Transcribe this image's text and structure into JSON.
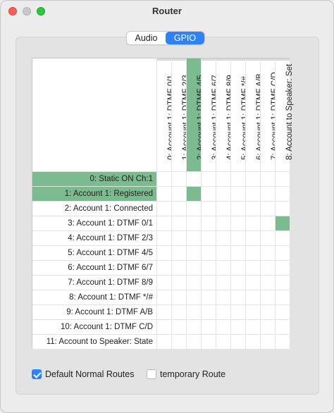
{
  "window": {
    "title": "Router"
  },
  "tabs": [
    {
      "label": "Audio",
      "active": false
    },
    {
      "label": "GPIO",
      "active": true
    }
  ],
  "accent_color": "#2d82f8",
  "route_color": "#7cbb8f",
  "columns": [
    {
      "label": "0: Account 1: DTMF 0/1",
      "active": false
    },
    {
      "label": "1: Account 1: DTMF 2/3",
      "active": false
    },
    {
      "label": "2: Account 1: DTMF 4/5",
      "active": true
    },
    {
      "label": "3: Account 1: DTMF 6/7",
      "active": false
    },
    {
      "label": "4: Account 1: DTMF 8/9",
      "active": false
    },
    {
      "label": "5: Account 1: DTMF */#",
      "active": false
    },
    {
      "label": "6: Account 1: DTMF A/B",
      "active": false
    },
    {
      "label": "7: Account 1: DTMF C/D",
      "active": false
    },
    {
      "label": "8:  Account to Speaker: Set",
      "active": false
    }
  ],
  "rows": [
    {
      "label": "0: Static ON Ch:1",
      "active": true
    },
    {
      "label": "1: Account 1: Registered",
      "active": true
    },
    {
      "label": "2: Account 1: Connected",
      "active": false
    },
    {
      "label": "3: Account 1: DTMF 0/1",
      "active": false
    },
    {
      "label": "4: Account 1: DTMF 2/3",
      "active": false
    },
    {
      "label": "5: Account 1: DTMF 4/5",
      "active": false
    },
    {
      "label": "6: Account 1: DTMF 6/7",
      "active": false
    },
    {
      "label": "7: Account 1: DTMF 8/9",
      "active": false
    },
    {
      "label": "8: Account 1: DTMF */#",
      "active": false
    },
    {
      "label": "9: Account 1: DTMF A/B",
      "active": false
    },
    {
      "label": "10: Account 1: DTMF C/D",
      "active": false
    },
    {
      "label": "11:  Account to Speaker: State",
      "active": false
    }
  ],
  "routes": [
    {
      "row": 1,
      "col": 2
    },
    {
      "row": 3,
      "col": 8
    }
  ],
  "options": {
    "default_normal_routes": {
      "label": "Default Normal Routes",
      "checked": true
    },
    "temporary_route": {
      "label": "temporary Route",
      "checked": false
    }
  }
}
